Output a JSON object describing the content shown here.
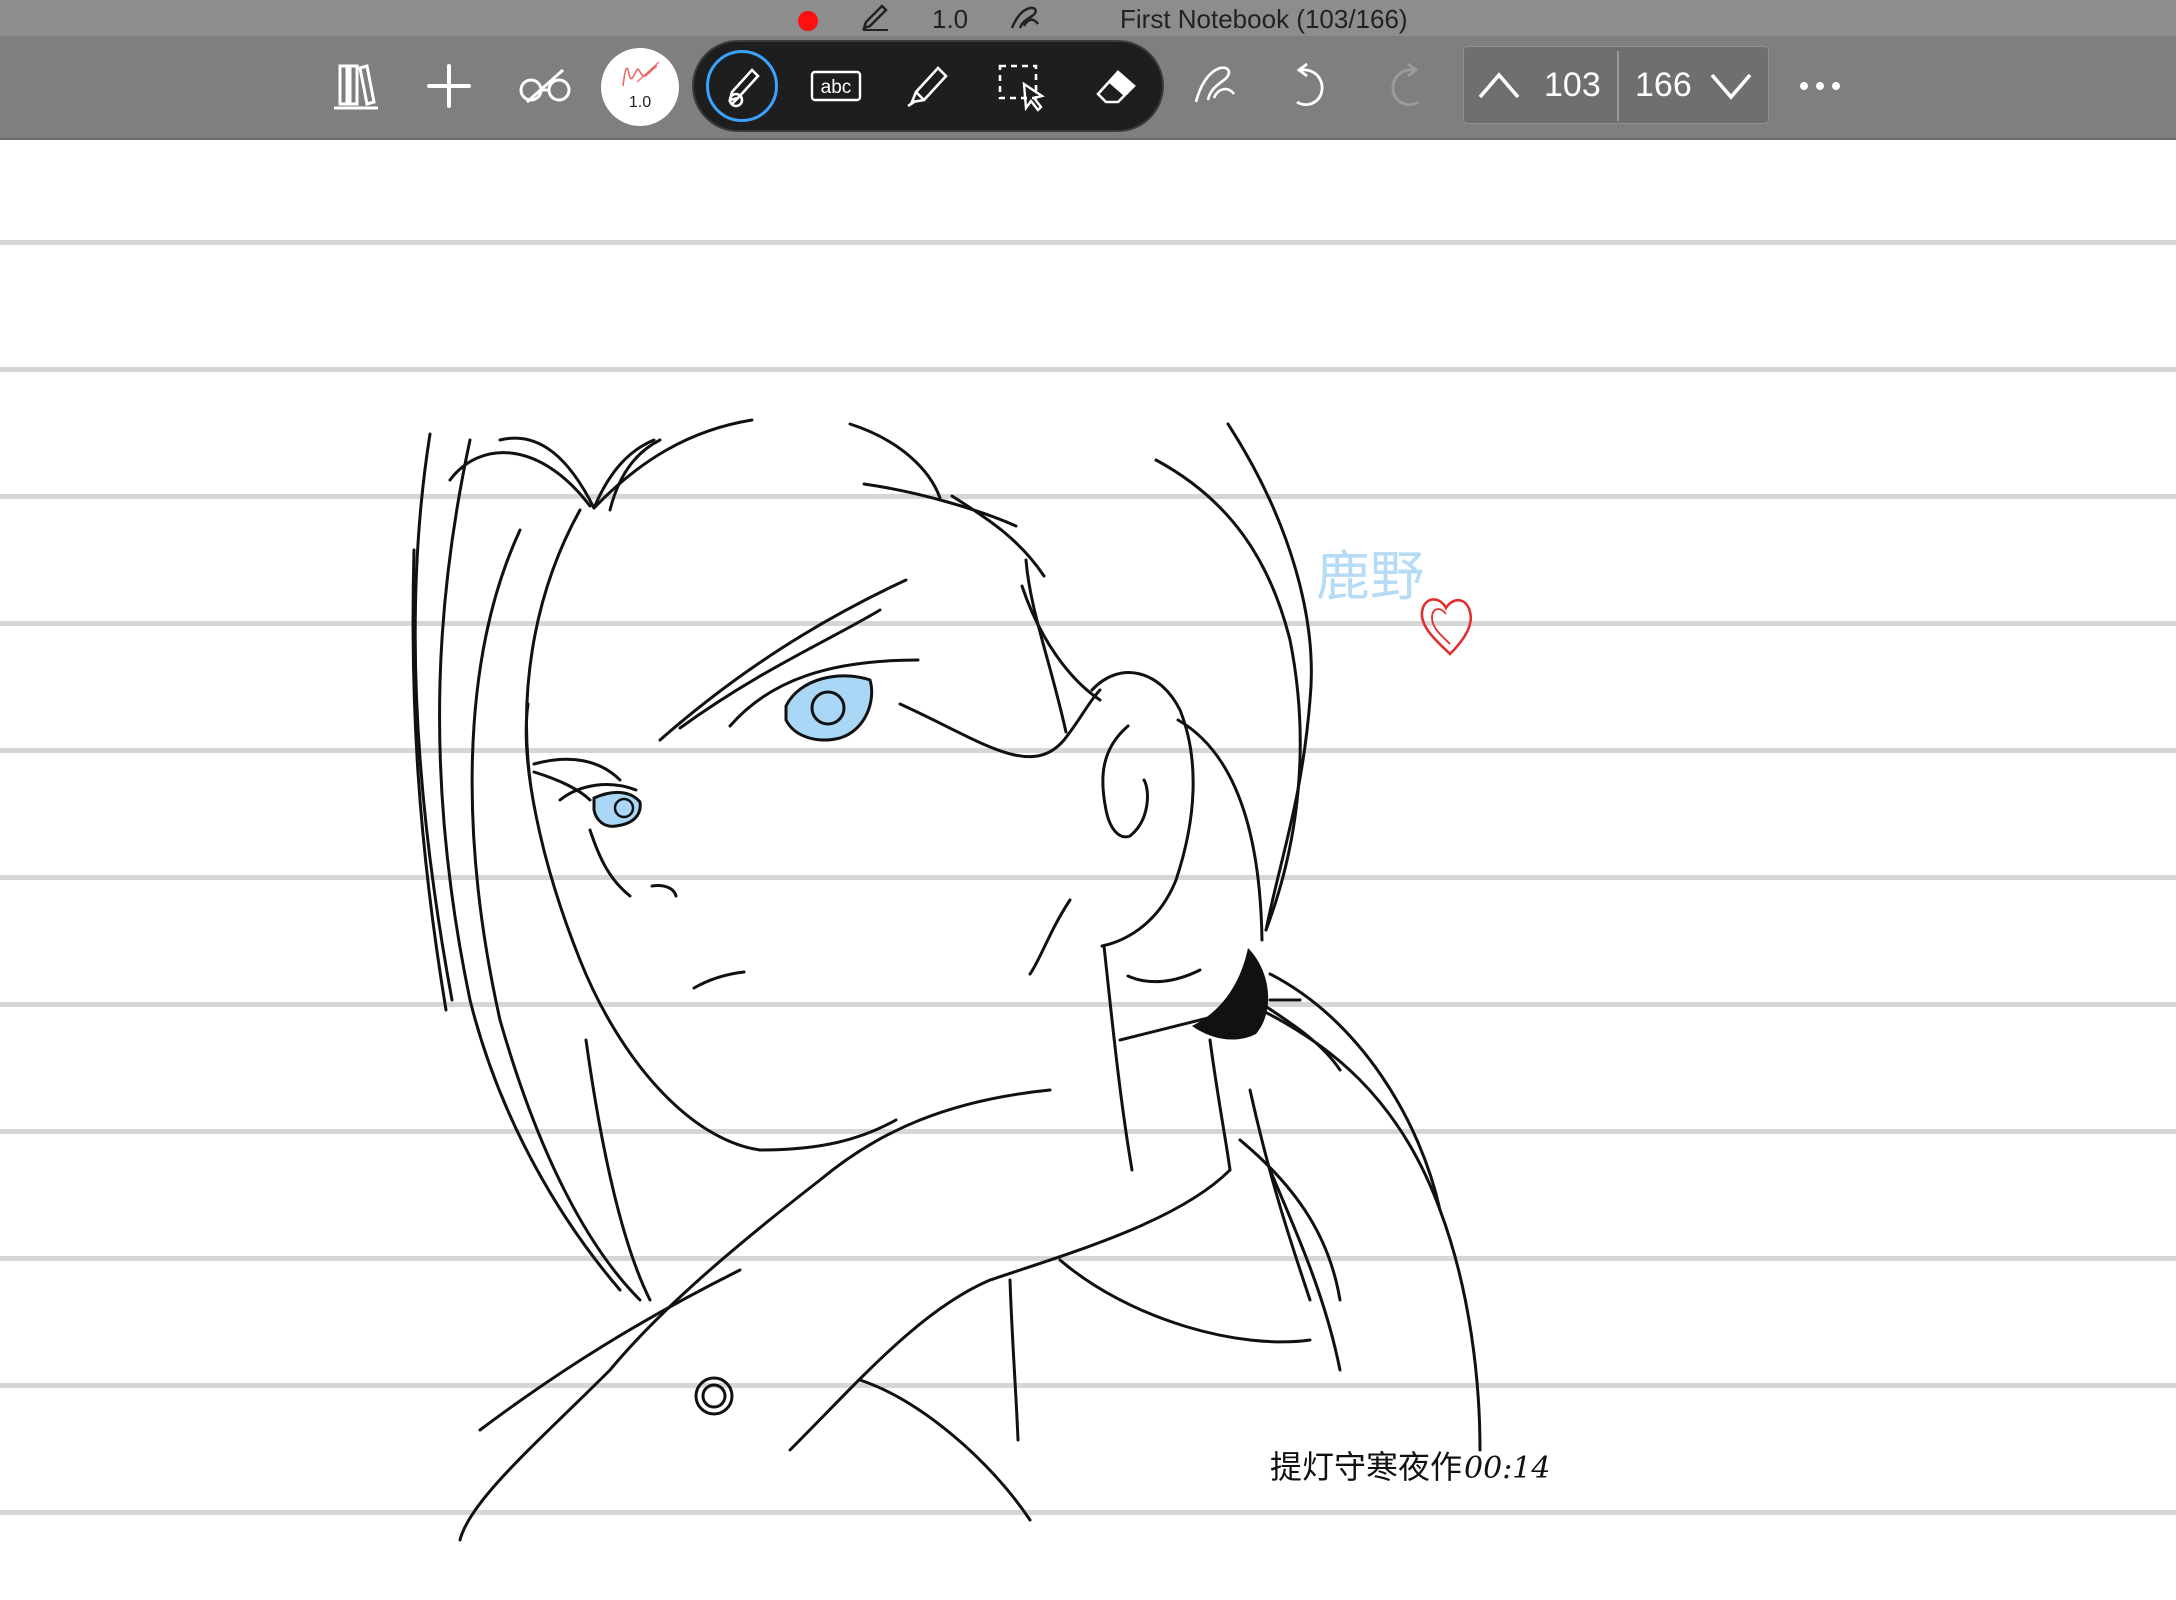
{
  "status_bar": {
    "recording_color": "#ff1010",
    "pen_size": "1.0",
    "notebook_title": "First Notebook (103/166)"
  },
  "toolbar": {
    "pen_preview_size": "1.0",
    "current_page": "103",
    "total_pages": "166",
    "active_tool": "pen",
    "accent_color": "#3aa3ff",
    "tools": [
      "library-icon",
      "add-page-icon",
      "reading-mode-icon",
      "pen-preview",
      "pen-icon",
      "text-icon",
      "highlighter-icon",
      "lasso-select-icon",
      "eraser-icon",
      "gesture-icon",
      "undo-icon",
      "redo-icon",
      "more-icon"
    ]
  },
  "canvas": {
    "text_tool_label": "abc",
    "signature_text": "提灯守寒夜作",
    "signature_time": "00:14",
    "watermark_text": "鹿野",
    "eye_color": "#a9d7f5",
    "ink_color": "#111111"
  }
}
